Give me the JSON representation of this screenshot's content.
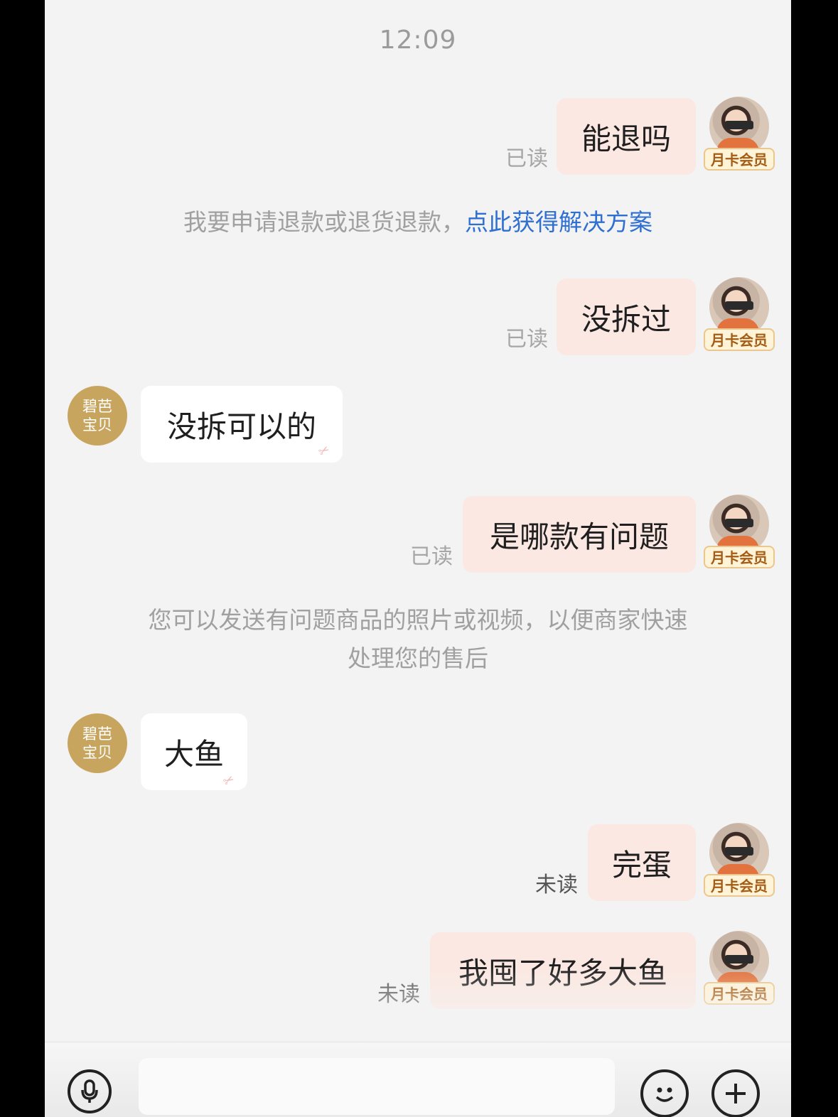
{
  "chat": {
    "time": "12:09",
    "member_badge": "月卡会员",
    "shop_avatar_lines": [
      "碧芭",
      "宝贝"
    ],
    "messages": [
      {
        "from": "me",
        "text": "能退吗",
        "status": "已读"
      },
      {
        "from": "me",
        "text": "没拆过",
        "status": "已读"
      },
      {
        "from": "them",
        "text": "没拆可以的"
      },
      {
        "from": "me",
        "text": "是哪款有问题",
        "status": "已读"
      },
      {
        "from": "them",
        "text": "大鱼"
      },
      {
        "from": "me",
        "text": "完蛋",
        "status": "未读"
      },
      {
        "from": "me",
        "text": "我囤了好多大鱼",
        "status": "未读"
      }
    ],
    "system_notice_1": {
      "text": "我要申请退款或退货退款，",
      "link": "点此获得解决方案"
    },
    "system_notice_2": {
      "line1": "您可以发送有问题商品的照片或视频，以便商家快速",
      "line2": "处理您的售后"
    }
  },
  "toolbar": {
    "voice_icon": "microphone-icon",
    "emoji_icon": "smile-icon",
    "plus_icon": "plus-icon"
  },
  "colors": {
    "my_bubble": "#fbe8e2",
    "their_bubble": "#ffffff",
    "link": "#2e6fd1",
    "shop_avatar": "#c8a55e"
  }
}
